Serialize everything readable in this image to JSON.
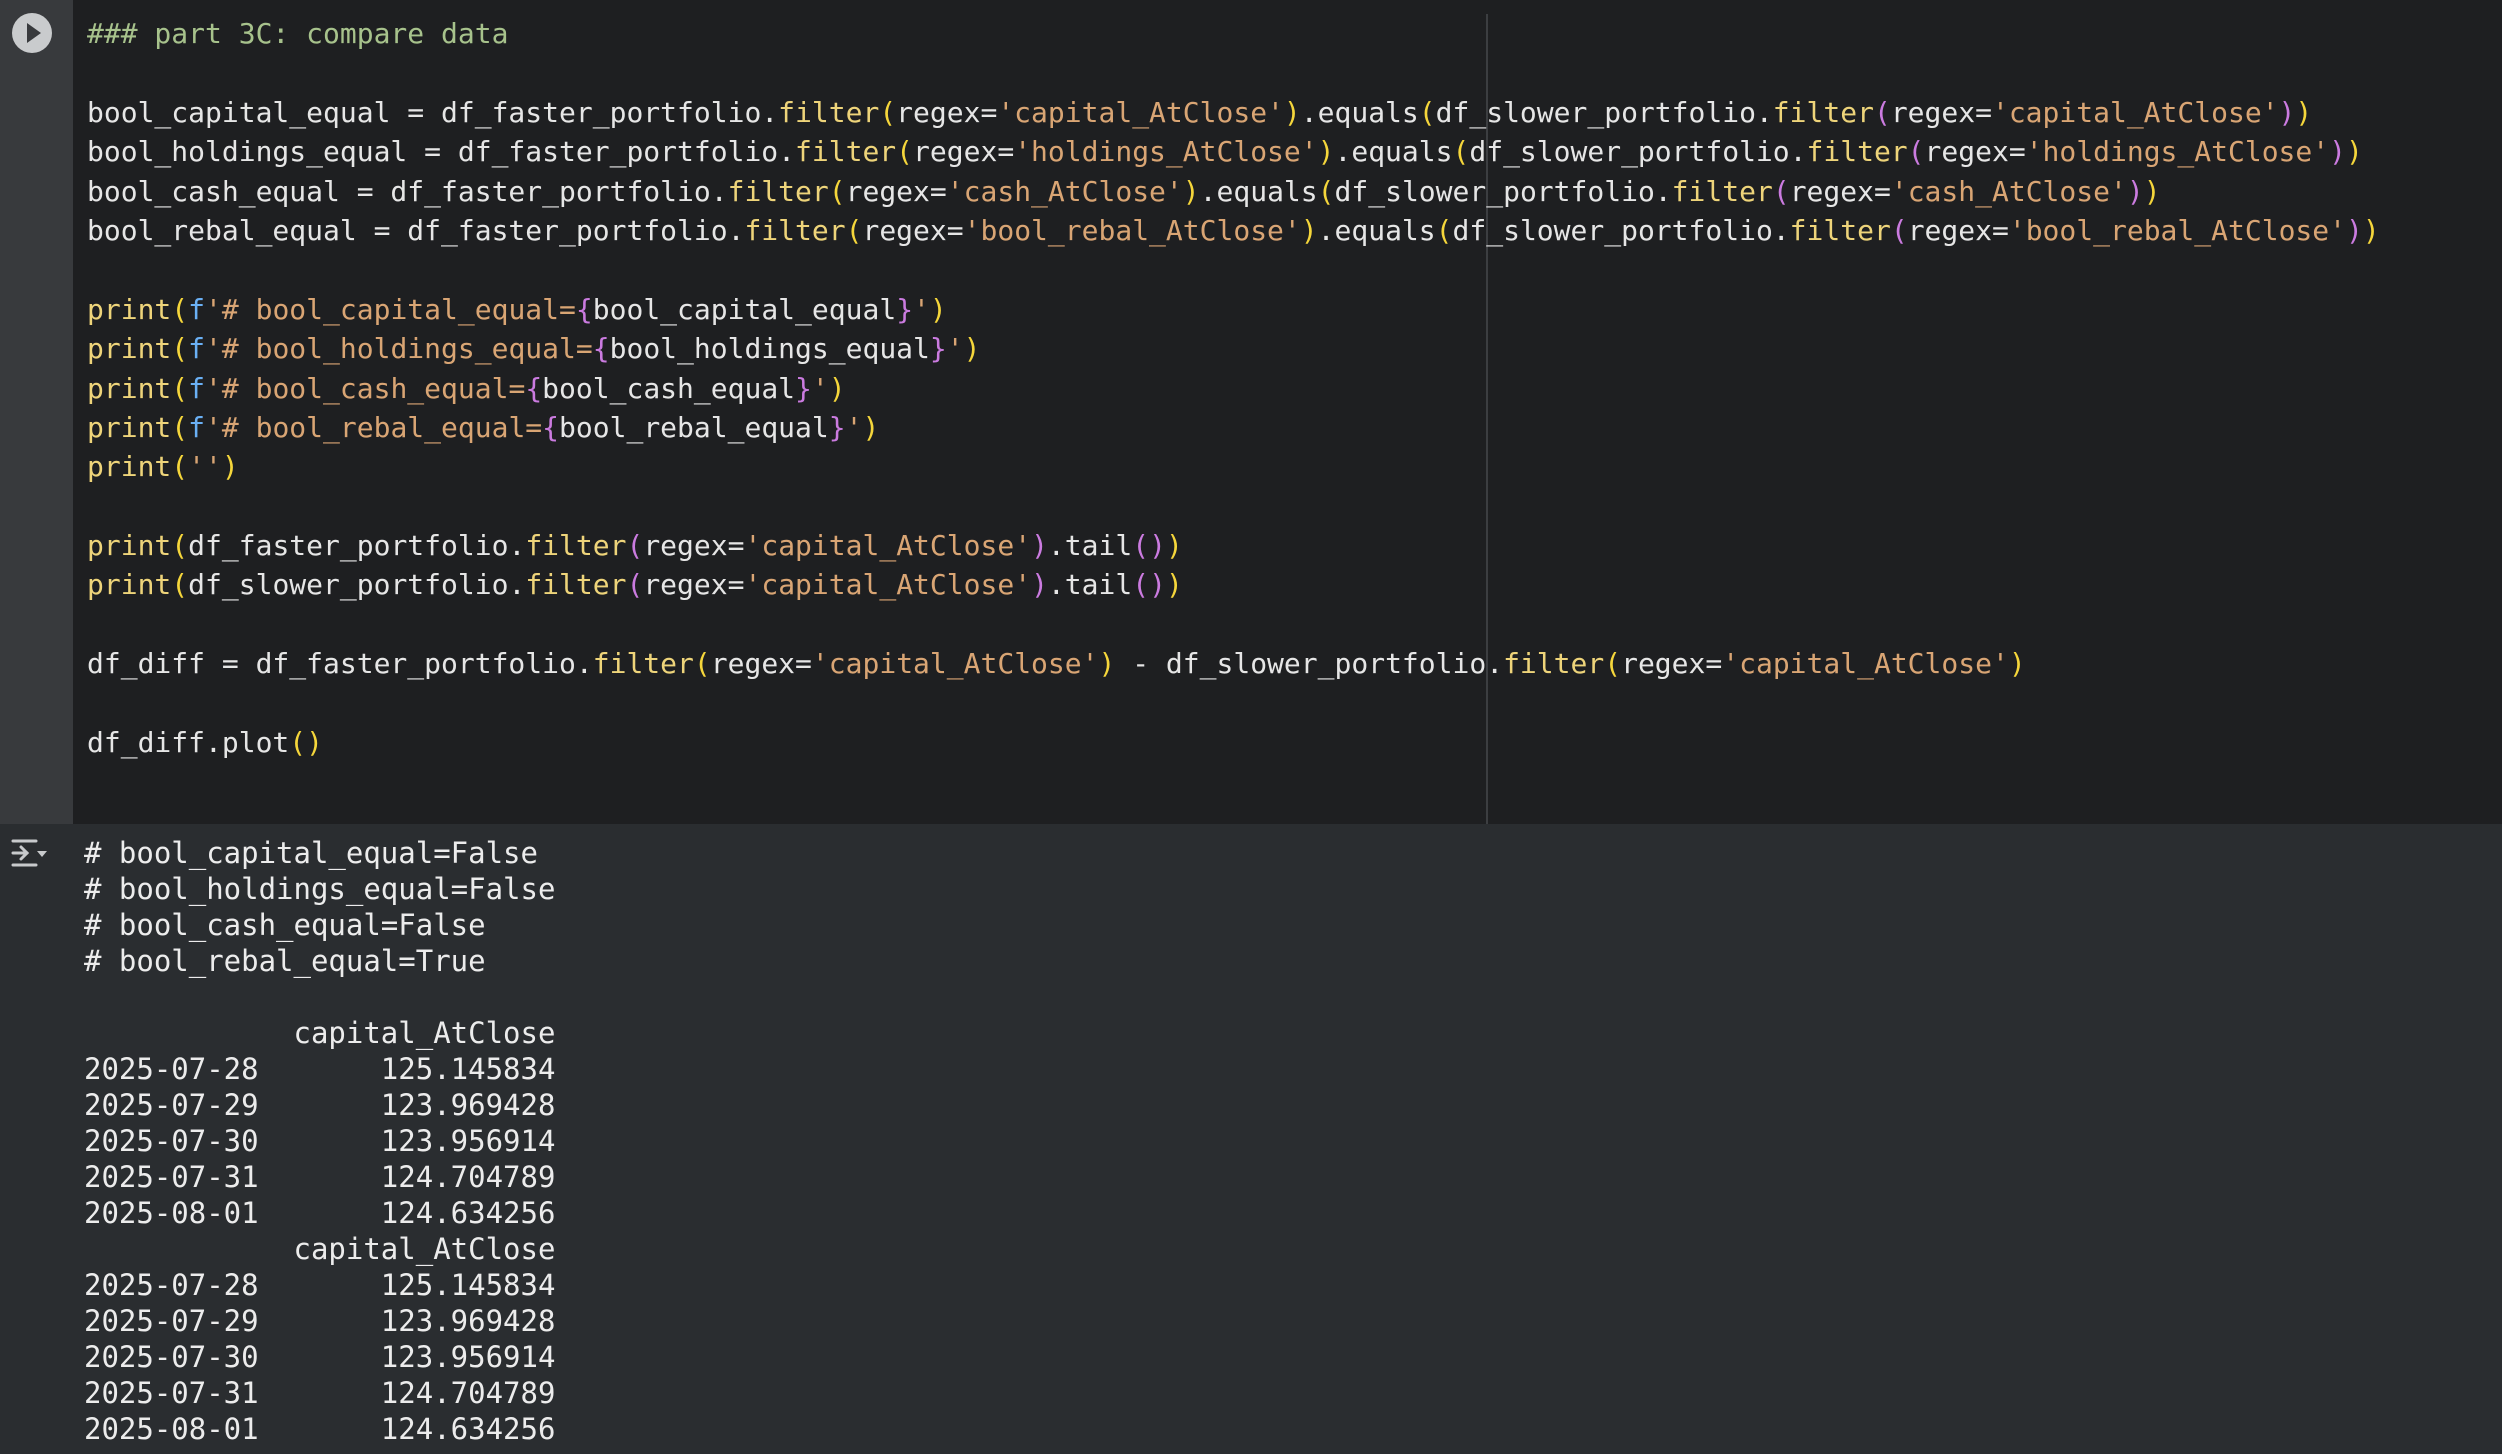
{
  "cell": {
    "code_lines": [
      [
        {
          "t": "### part 3C: compare data",
          "c": "comment"
        }
      ],
      [],
      [
        {
          "t": "bool_capital_equal = df_faster_portfolio.",
          "c": "text"
        },
        {
          "t": "filter",
          "c": "func"
        },
        {
          "t": "(",
          "c": "b1"
        },
        {
          "t": "regex=",
          "c": "text"
        },
        {
          "t": "'capital_AtClose'",
          "c": "str"
        },
        {
          "t": ")",
          "c": "b1"
        },
        {
          "t": ".equals",
          "c": "text"
        },
        {
          "t": "(",
          "c": "b1"
        },
        {
          "t": "df_slower_portfolio.",
          "c": "text"
        },
        {
          "t": "filter",
          "c": "func"
        },
        {
          "t": "(",
          "c": "b2"
        },
        {
          "t": "regex=",
          "c": "text"
        },
        {
          "t": "'capital_AtClose'",
          "c": "str"
        },
        {
          "t": ")",
          "c": "b2"
        },
        {
          "t": ")",
          "c": "b1"
        }
      ],
      [
        {
          "t": "bool_holdings_equal = df_faster_portfolio.",
          "c": "text"
        },
        {
          "t": "filter",
          "c": "func"
        },
        {
          "t": "(",
          "c": "b1"
        },
        {
          "t": "regex=",
          "c": "text"
        },
        {
          "t": "'holdings_AtClose'",
          "c": "str"
        },
        {
          "t": ")",
          "c": "b1"
        },
        {
          "t": ".equals",
          "c": "text"
        },
        {
          "t": "(",
          "c": "b1"
        },
        {
          "t": "df_slower_portfolio.",
          "c": "text"
        },
        {
          "t": "filter",
          "c": "func"
        },
        {
          "t": "(",
          "c": "b2"
        },
        {
          "t": "regex=",
          "c": "text"
        },
        {
          "t": "'holdings_AtClose'",
          "c": "str"
        },
        {
          "t": ")",
          "c": "b2"
        },
        {
          "t": ")",
          "c": "b1"
        }
      ],
      [
        {
          "t": "bool_cash_equal = df_faster_portfolio.",
          "c": "text"
        },
        {
          "t": "filter",
          "c": "func"
        },
        {
          "t": "(",
          "c": "b1"
        },
        {
          "t": "regex=",
          "c": "text"
        },
        {
          "t": "'cash_AtClose'",
          "c": "str"
        },
        {
          "t": ")",
          "c": "b1"
        },
        {
          "t": ".equals",
          "c": "text"
        },
        {
          "t": "(",
          "c": "b1"
        },
        {
          "t": "df_slower_portfolio.",
          "c": "text"
        },
        {
          "t": "filter",
          "c": "func"
        },
        {
          "t": "(",
          "c": "b2"
        },
        {
          "t": "regex=",
          "c": "text"
        },
        {
          "t": "'cash_AtClose'",
          "c": "str"
        },
        {
          "t": ")",
          "c": "b2"
        },
        {
          "t": ")",
          "c": "b1"
        }
      ],
      [
        {
          "t": "bool_rebal_equal = df_faster_portfolio.",
          "c": "text"
        },
        {
          "t": "filter",
          "c": "func"
        },
        {
          "t": "(",
          "c": "b1"
        },
        {
          "t": "regex=",
          "c": "text"
        },
        {
          "t": "'bool_rebal_AtClose'",
          "c": "str"
        },
        {
          "t": ")",
          "c": "b1"
        },
        {
          "t": ".equals",
          "c": "text"
        },
        {
          "t": "(",
          "c": "b1"
        },
        {
          "t": "df_slower_portfolio.",
          "c": "text"
        },
        {
          "t": "filter",
          "c": "func"
        },
        {
          "t": "(",
          "c": "b2"
        },
        {
          "t": "regex=",
          "c": "text"
        },
        {
          "t": "'bool_rebal_AtClose'",
          "c": "str"
        },
        {
          "t": ")",
          "c": "b2"
        },
        {
          "t": ")",
          "c": "b1"
        }
      ],
      [],
      [
        {
          "t": "print",
          "c": "func"
        },
        {
          "t": "(",
          "c": "b1"
        },
        {
          "t": "f",
          "c": "fpre"
        },
        {
          "t": "'# bool_capital_equal=",
          "c": "str"
        },
        {
          "t": "{",
          "c": "brace"
        },
        {
          "t": "bool_capital_equal",
          "c": "text"
        },
        {
          "t": "}",
          "c": "brace"
        },
        {
          "t": "'",
          "c": "str"
        },
        {
          "t": ")",
          "c": "b1"
        }
      ],
      [
        {
          "t": "print",
          "c": "func"
        },
        {
          "t": "(",
          "c": "b1"
        },
        {
          "t": "f",
          "c": "fpre"
        },
        {
          "t": "'# bool_holdings_equal=",
          "c": "str"
        },
        {
          "t": "{",
          "c": "brace"
        },
        {
          "t": "bool_holdings_equal",
          "c": "text"
        },
        {
          "t": "}",
          "c": "brace"
        },
        {
          "t": "'",
          "c": "str"
        },
        {
          "t": ")",
          "c": "b1"
        }
      ],
      [
        {
          "t": "print",
          "c": "func"
        },
        {
          "t": "(",
          "c": "b1"
        },
        {
          "t": "f",
          "c": "fpre"
        },
        {
          "t": "'# bool_cash_equal=",
          "c": "str"
        },
        {
          "t": "{",
          "c": "brace"
        },
        {
          "t": "bool_cash_equal",
          "c": "text"
        },
        {
          "t": "}",
          "c": "brace"
        },
        {
          "t": "'",
          "c": "str"
        },
        {
          "t": ")",
          "c": "b1"
        }
      ],
      [
        {
          "t": "print",
          "c": "func"
        },
        {
          "t": "(",
          "c": "b1"
        },
        {
          "t": "f",
          "c": "fpre"
        },
        {
          "t": "'# bool_rebal_equal=",
          "c": "str"
        },
        {
          "t": "{",
          "c": "brace"
        },
        {
          "t": "bool_rebal_equal",
          "c": "text"
        },
        {
          "t": "}",
          "c": "brace"
        },
        {
          "t": "'",
          "c": "str"
        },
        {
          "t": ")",
          "c": "b1"
        }
      ],
      [
        {
          "t": "print",
          "c": "func"
        },
        {
          "t": "(",
          "c": "b1"
        },
        {
          "t": "''",
          "c": "str"
        },
        {
          "t": ")",
          "c": "b1"
        }
      ],
      [],
      [
        {
          "t": "print",
          "c": "func"
        },
        {
          "t": "(",
          "c": "b1"
        },
        {
          "t": "df_faster_portfolio.",
          "c": "text"
        },
        {
          "t": "filter",
          "c": "func"
        },
        {
          "t": "(",
          "c": "b2"
        },
        {
          "t": "regex=",
          "c": "text"
        },
        {
          "t": "'capital_AtClose'",
          "c": "str"
        },
        {
          "t": ")",
          "c": "b2"
        },
        {
          "t": ".tail",
          "c": "text"
        },
        {
          "t": "(",
          "c": "b2"
        },
        {
          "t": ")",
          "c": "b2"
        },
        {
          "t": ")",
          "c": "b1"
        }
      ],
      [
        {
          "t": "print",
          "c": "func"
        },
        {
          "t": "(",
          "c": "b1"
        },
        {
          "t": "df_slower_portfolio.",
          "c": "text"
        },
        {
          "t": "filter",
          "c": "func"
        },
        {
          "t": "(",
          "c": "b2"
        },
        {
          "t": "regex=",
          "c": "text"
        },
        {
          "t": "'capital_AtClose'",
          "c": "str"
        },
        {
          "t": ")",
          "c": "b2"
        },
        {
          "t": ".tail",
          "c": "text"
        },
        {
          "t": "(",
          "c": "b2"
        },
        {
          "t": ")",
          "c": "b2"
        },
        {
          "t": ")",
          "c": "b1"
        }
      ],
      [],
      [
        {
          "t": "df_diff = df_faster_portfolio.",
          "c": "text"
        },
        {
          "t": "filter",
          "c": "func"
        },
        {
          "t": "(",
          "c": "b1"
        },
        {
          "t": "regex=",
          "c": "text"
        },
        {
          "t": "'capital_AtClose'",
          "c": "str"
        },
        {
          "t": ")",
          "c": "b1"
        },
        {
          "t": " - df_slower_portfolio.",
          "c": "text"
        },
        {
          "t": "filter",
          "c": "func"
        },
        {
          "t": "(",
          "c": "b1"
        },
        {
          "t": "regex=",
          "c": "text"
        },
        {
          "t": "'capital_AtClose'",
          "c": "str"
        },
        {
          "t": ")",
          "c": "b1"
        }
      ],
      [],
      [
        {
          "t": "df_diff.plot",
          "c": "text"
        },
        {
          "t": "(",
          "c": "b1"
        },
        {
          "t": ")",
          "c": "b1"
        }
      ]
    ]
  },
  "output": {
    "lines": [
      "# bool_capital_equal=False",
      "# bool_holdings_equal=False",
      "# bool_cash_equal=False",
      "# bool_rebal_equal=True",
      "",
      "            capital_AtClose",
      "2025-07-28       125.145834",
      "2025-07-29       123.969428",
      "2025-07-30       123.956914",
      "2025-07-31       124.704789",
      "2025-08-01       124.634256",
      "            capital_AtClose",
      "2025-07-28       125.145834",
      "2025-07-29       123.969428",
      "2025-07-30       123.956914",
      "2025-07-31       124.704789",
      "2025-08-01       124.634256"
    ]
  },
  "colors": {
    "cell_bg": "#1e1f21",
    "gutter_bg": "#383a3d",
    "output_bg": "#2a2d30",
    "comment": "#a7c28c",
    "function": "#eed47a",
    "string": "#d9a574",
    "bracket_level_1": "#f5d63b",
    "bracket_level_2": "#cb7be0"
  },
  "icons": {
    "run": "play-circle-icon",
    "output_toggle": "collapse-output-icon"
  }
}
